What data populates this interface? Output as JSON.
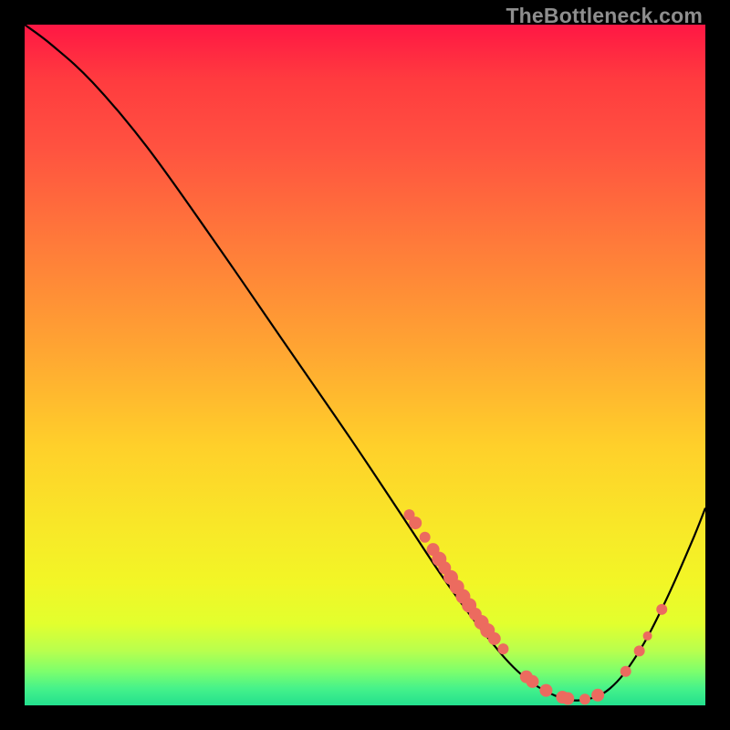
{
  "watermark": "TheBottleneck.com",
  "chart_data": {
    "type": "line",
    "title": "",
    "xlabel": "",
    "ylabel": "",
    "xlim": [
      0,
      100
    ],
    "ylim": [
      0,
      100
    ],
    "curve": [
      {
        "x": 0.0,
        "y": 100.0
      },
      {
        "x": 4.0,
        "y": 97.0
      },
      {
        "x": 10.0,
        "y": 91.5
      },
      {
        "x": 18.0,
        "y": 82.0
      },
      {
        "x": 28.0,
        "y": 68.0
      },
      {
        "x": 38.0,
        "y": 53.5
      },
      {
        "x": 48.0,
        "y": 39.0
      },
      {
        "x": 56.0,
        "y": 27.0
      },
      {
        "x": 62.0,
        "y": 18.0
      },
      {
        "x": 68.0,
        "y": 10.0
      },
      {
        "x": 73.0,
        "y": 4.5
      },
      {
        "x": 78.0,
        "y": 1.4
      },
      {
        "x": 82.0,
        "y": 0.8
      },
      {
        "x": 86.0,
        "y": 2.5
      },
      {
        "x": 90.0,
        "y": 7.5
      },
      {
        "x": 94.0,
        "y": 15.0
      },
      {
        "x": 98.0,
        "y": 24.0
      },
      {
        "x": 100.0,
        "y": 29.0
      }
    ],
    "markers": [
      {
        "x": 56.5,
        "y": 28.0,
        "r": 6
      },
      {
        "x": 57.4,
        "y": 26.8,
        "r": 7
      },
      {
        "x": 58.8,
        "y": 24.7,
        "r": 6
      },
      {
        "x": 60.0,
        "y": 22.9,
        "r": 7
      },
      {
        "x": 60.9,
        "y": 21.5,
        "r": 8
      },
      {
        "x": 61.7,
        "y": 20.2,
        "r": 7
      },
      {
        "x": 62.6,
        "y": 18.8,
        "r": 8
      },
      {
        "x": 63.5,
        "y": 17.4,
        "r": 8
      },
      {
        "x": 64.4,
        "y": 16.0,
        "r": 8
      },
      {
        "x": 65.3,
        "y": 14.7,
        "r": 8
      },
      {
        "x": 66.2,
        "y": 13.4,
        "r": 7
      },
      {
        "x": 67.1,
        "y": 12.2,
        "r": 8
      },
      {
        "x": 68.0,
        "y": 11.0,
        "r": 8
      },
      {
        "x": 69.0,
        "y": 9.8,
        "r": 7
      },
      {
        "x": 70.3,
        "y": 8.3,
        "r": 6
      },
      {
        "x": 73.7,
        "y": 4.2,
        "r": 7
      },
      {
        "x": 74.6,
        "y": 3.5,
        "r": 7
      },
      {
        "x": 76.6,
        "y": 2.2,
        "r": 7
      },
      {
        "x": 79.0,
        "y": 1.2,
        "r": 7
      },
      {
        "x": 79.8,
        "y": 1.0,
        "r": 7
      },
      {
        "x": 82.3,
        "y": 0.9,
        "r": 6
      },
      {
        "x": 84.2,
        "y": 1.5,
        "r": 7
      },
      {
        "x": 88.3,
        "y": 5.0,
        "r": 6
      },
      {
        "x": 90.3,
        "y": 8.0,
        "r": 6
      },
      {
        "x": 91.5,
        "y": 10.2,
        "r": 5
      },
      {
        "x": 93.6,
        "y": 14.1,
        "r": 6
      }
    ],
    "marker_color": "#ec6b5f",
    "line_color": "#000000"
  }
}
